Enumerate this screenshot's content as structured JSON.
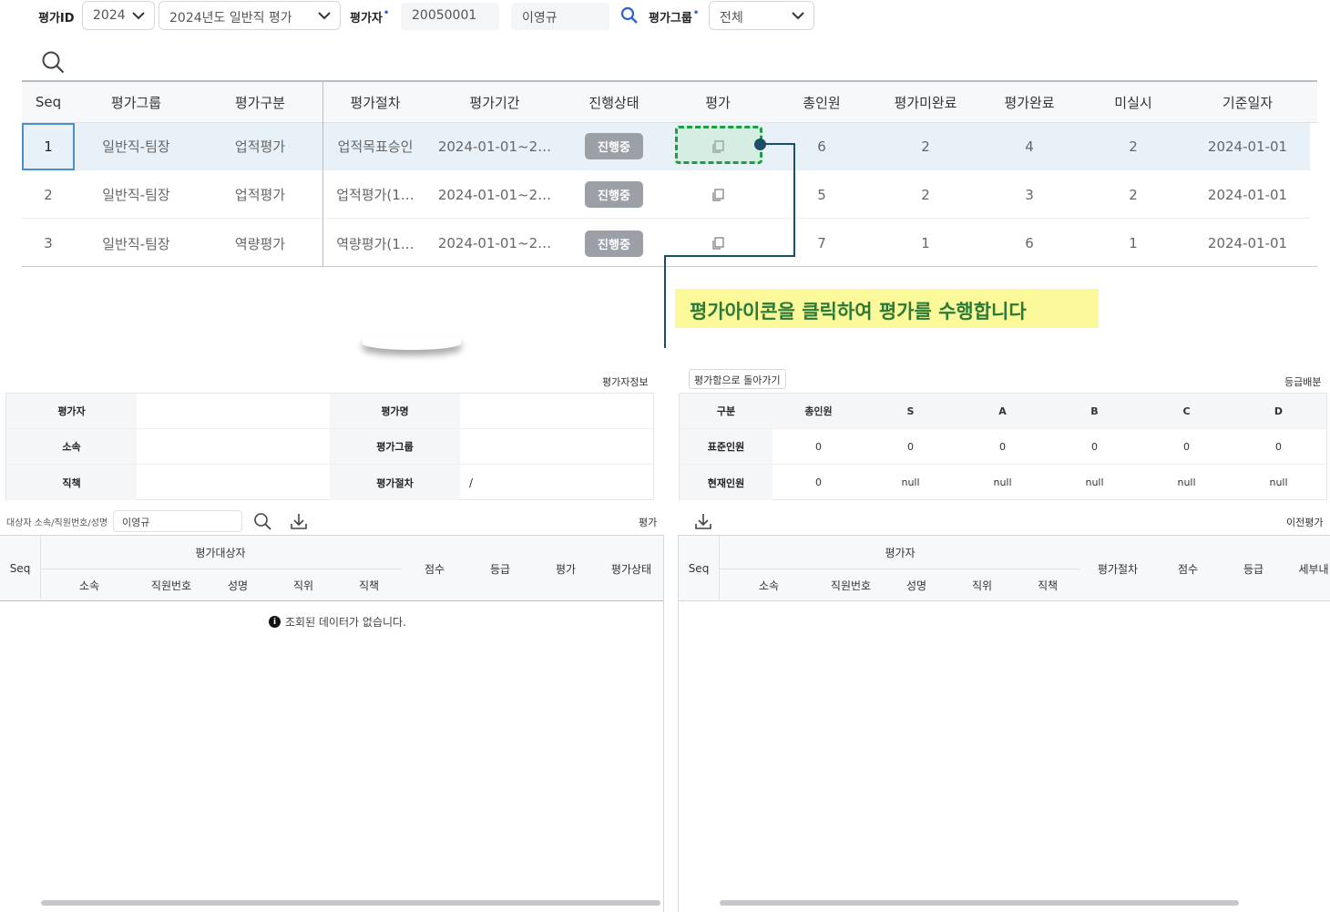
{
  "filters": {
    "eval_id_label": "평가ID",
    "year": "2024",
    "eval_name": "2024년도 일반직 평가",
    "evaluator_label": "평가자",
    "evaluator_id": "20050001",
    "evaluator_name": "이영규",
    "group_label": "평가그룹",
    "group_value": "전체"
  },
  "top_grid": {
    "headers": [
      "Seq",
      "평가그룹",
      "평가구분",
      "평가절차",
      "평가기간",
      "진행상태",
      "평가",
      "총인원",
      "평가미완료",
      "평가완료",
      "미실시",
      "기준일자"
    ],
    "rows": [
      {
        "seq": "1",
        "group": "일반직-팀장",
        "type": "업적평가",
        "step": "업적목표승인",
        "period": "2024-01-01~2…",
        "status": "진행중",
        "total": "6",
        "incomplete": "2",
        "complete": "4",
        "not_done": "2",
        "base_date": "2024-01-01"
      },
      {
        "seq": "2",
        "group": "일반직-팀장",
        "type": "업적평가",
        "step": "업적평가(1…",
        "period": "2024-01-01~2…",
        "status": "진행중",
        "total": "5",
        "incomplete": "2",
        "complete": "3",
        "not_done": "2",
        "base_date": "2024-01-01"
      },
      {
        "seq": "3",
        "group": "일반직-팀장",
        "type": "역량평가",
        "step": "역량평가(1…",
        "period": "2024-01-01~2…",
        "status": "진행중",
        "total": "7",
        "incomplete": "1",
        "complete": "6",
        "not_done": "1",
        "base_date": "2024-01-01"
      }
    ]
  },
  "callout": "평가아이콘을 클릭하여 평가를 수행합니다",
  "evaluator_info": {
    "title": "평가자정보",
    "labels": [
      "평가자",
      "평가명",
      "소속",
      "평가그룹",
      "직책",
      "평가절차"
    ],
    "step_value": "/"
  },
  "grade": {
    "back_label": "평가함으로 돌아가기",
    "title": "등급배분",
    "headers": [
      "구분",
      "총인원",
      "S",
      "A",
      "B",
      "C",
      "D"
    ],
    "rows": [
      {
        "label": "표준인원",
        "values": [
          "0",
          "0",
          "0",
          "0",
          "0",
          "0"
        ]
      },
      {
        "label": "현재인원",
        "values": [
          "0",
          "null",
          "null",
          "null",
          "null",
          "null"
        ]
      }
    ]
  },
  "left_list": {
    "search_label": "대상자 소속/직원번호/성명",
    "search_value": "이영규",
    "title": "평가",
    "headers": {
      "seq": "Seq",
      "group": "평가대상자",
      "sub": [
        "소속",
        "직원번호",
        "성명",
        "직위",
        "직책"
      ],
      "rest": [
        "점수",
        "등급",
        "평가",
        "평가상태"
      ]
    },
    "no_data": "조회된 데이터가 없습니다."
  },
  "right_list": {
    "title": "이전평가",
    "headers": {
      "seq": "Seq",
      "group": "평가자",
      "sub": [
        "소속",
        "직원번호",
        "성명",
        "직위",
        "직책"
      ],
      "rest": [
        "평가절차",
        "점수",
        "등급",
        "세부내"
      ]
    }
  },
  "colors": {
    "accent": "#2a62d6",
    "callout_bg": "#fbf99a",
    "highlight": "#1aa043",
    "connector": "#1c4f66"
  }
}
